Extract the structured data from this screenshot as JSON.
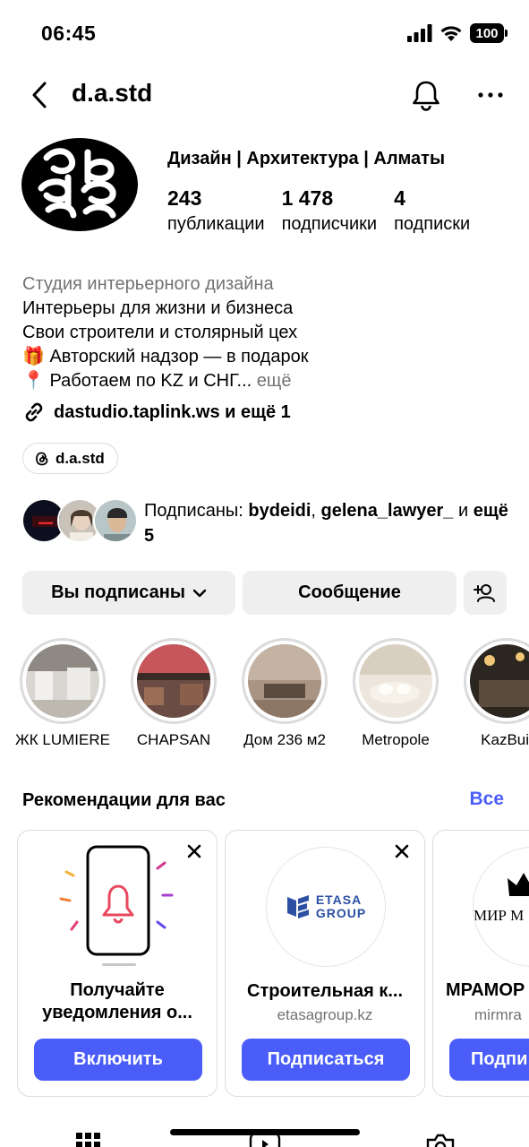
{
  "status": {
    "time": "06:45",
    "battery": "100"
  },
  "header": {
    "username": "d.a.std"
  },
  "profile": {
    "category": "Дизайн | Архитектура | Алматы",
    "stats": [
      {
        "num": "243",
        "label": "публикации"
      },
      {
        "num": "1 478",
        "label": "подписчики"
      },
      {
        "num": "4",
        "label": "подписки"
      }
    ],
    "bio": {
      "category_label": "Студия интерьерного дизайна",
      "line1": "Интерьеры для жизни и бизнеса",
      "line2": "Свои строители и столярный цех",
      "line3": "🎁 Авторский надзор — в подарок",
      "line4": "📍 Работаем по KZ и СНГ...",
      "more": "ещё"
    },
    "link": "dastudio.taplink.ws и ещё 1",
    "threads_handle": "d.a.std",
    "followed_by": {
      "prefix": "Подписаны: ",
      "user1": "bydeidi",
      "sep": ", ",
      "user2": "gelena_lawyer_",
      "suffix": " и ",
      "more": "ещё 5"
    }
  },
  "actions": {
    "following": "Вы подписаны",
    "message": "Сообщение"
  },
  "highlights": [
    {
      "label": "ЖК LUMIERE"
    },
    {
      "label": "CHAPSAN"
    },
    {
      "label": "Дом 236 м2"
    },
    {
      "label": "Metropole"
    },
    {
      "label": "KazBuil"
    }
  ],
  "recommendations": {
    "title": "Рекомендации для вас",
    "all": "Все",
    "cards": [
      {
        "name_line1": "Получайте",
        "name_line2": "уведомления о...",
        "button": "Включить"
      },
      {
        "logo_line1": "ETASA",
        "logo_line2": "GROUP",
        "name": "Строительная к...",
        "sub": "etasagroup.kz",
        "button": "Подписаться"
      },
      {
        "logo_text": "МИР М",
        "name": "МРАМОР",
        "sub": "mirmra",
        "button": "Подпи"
      }
    ]
  }
}
